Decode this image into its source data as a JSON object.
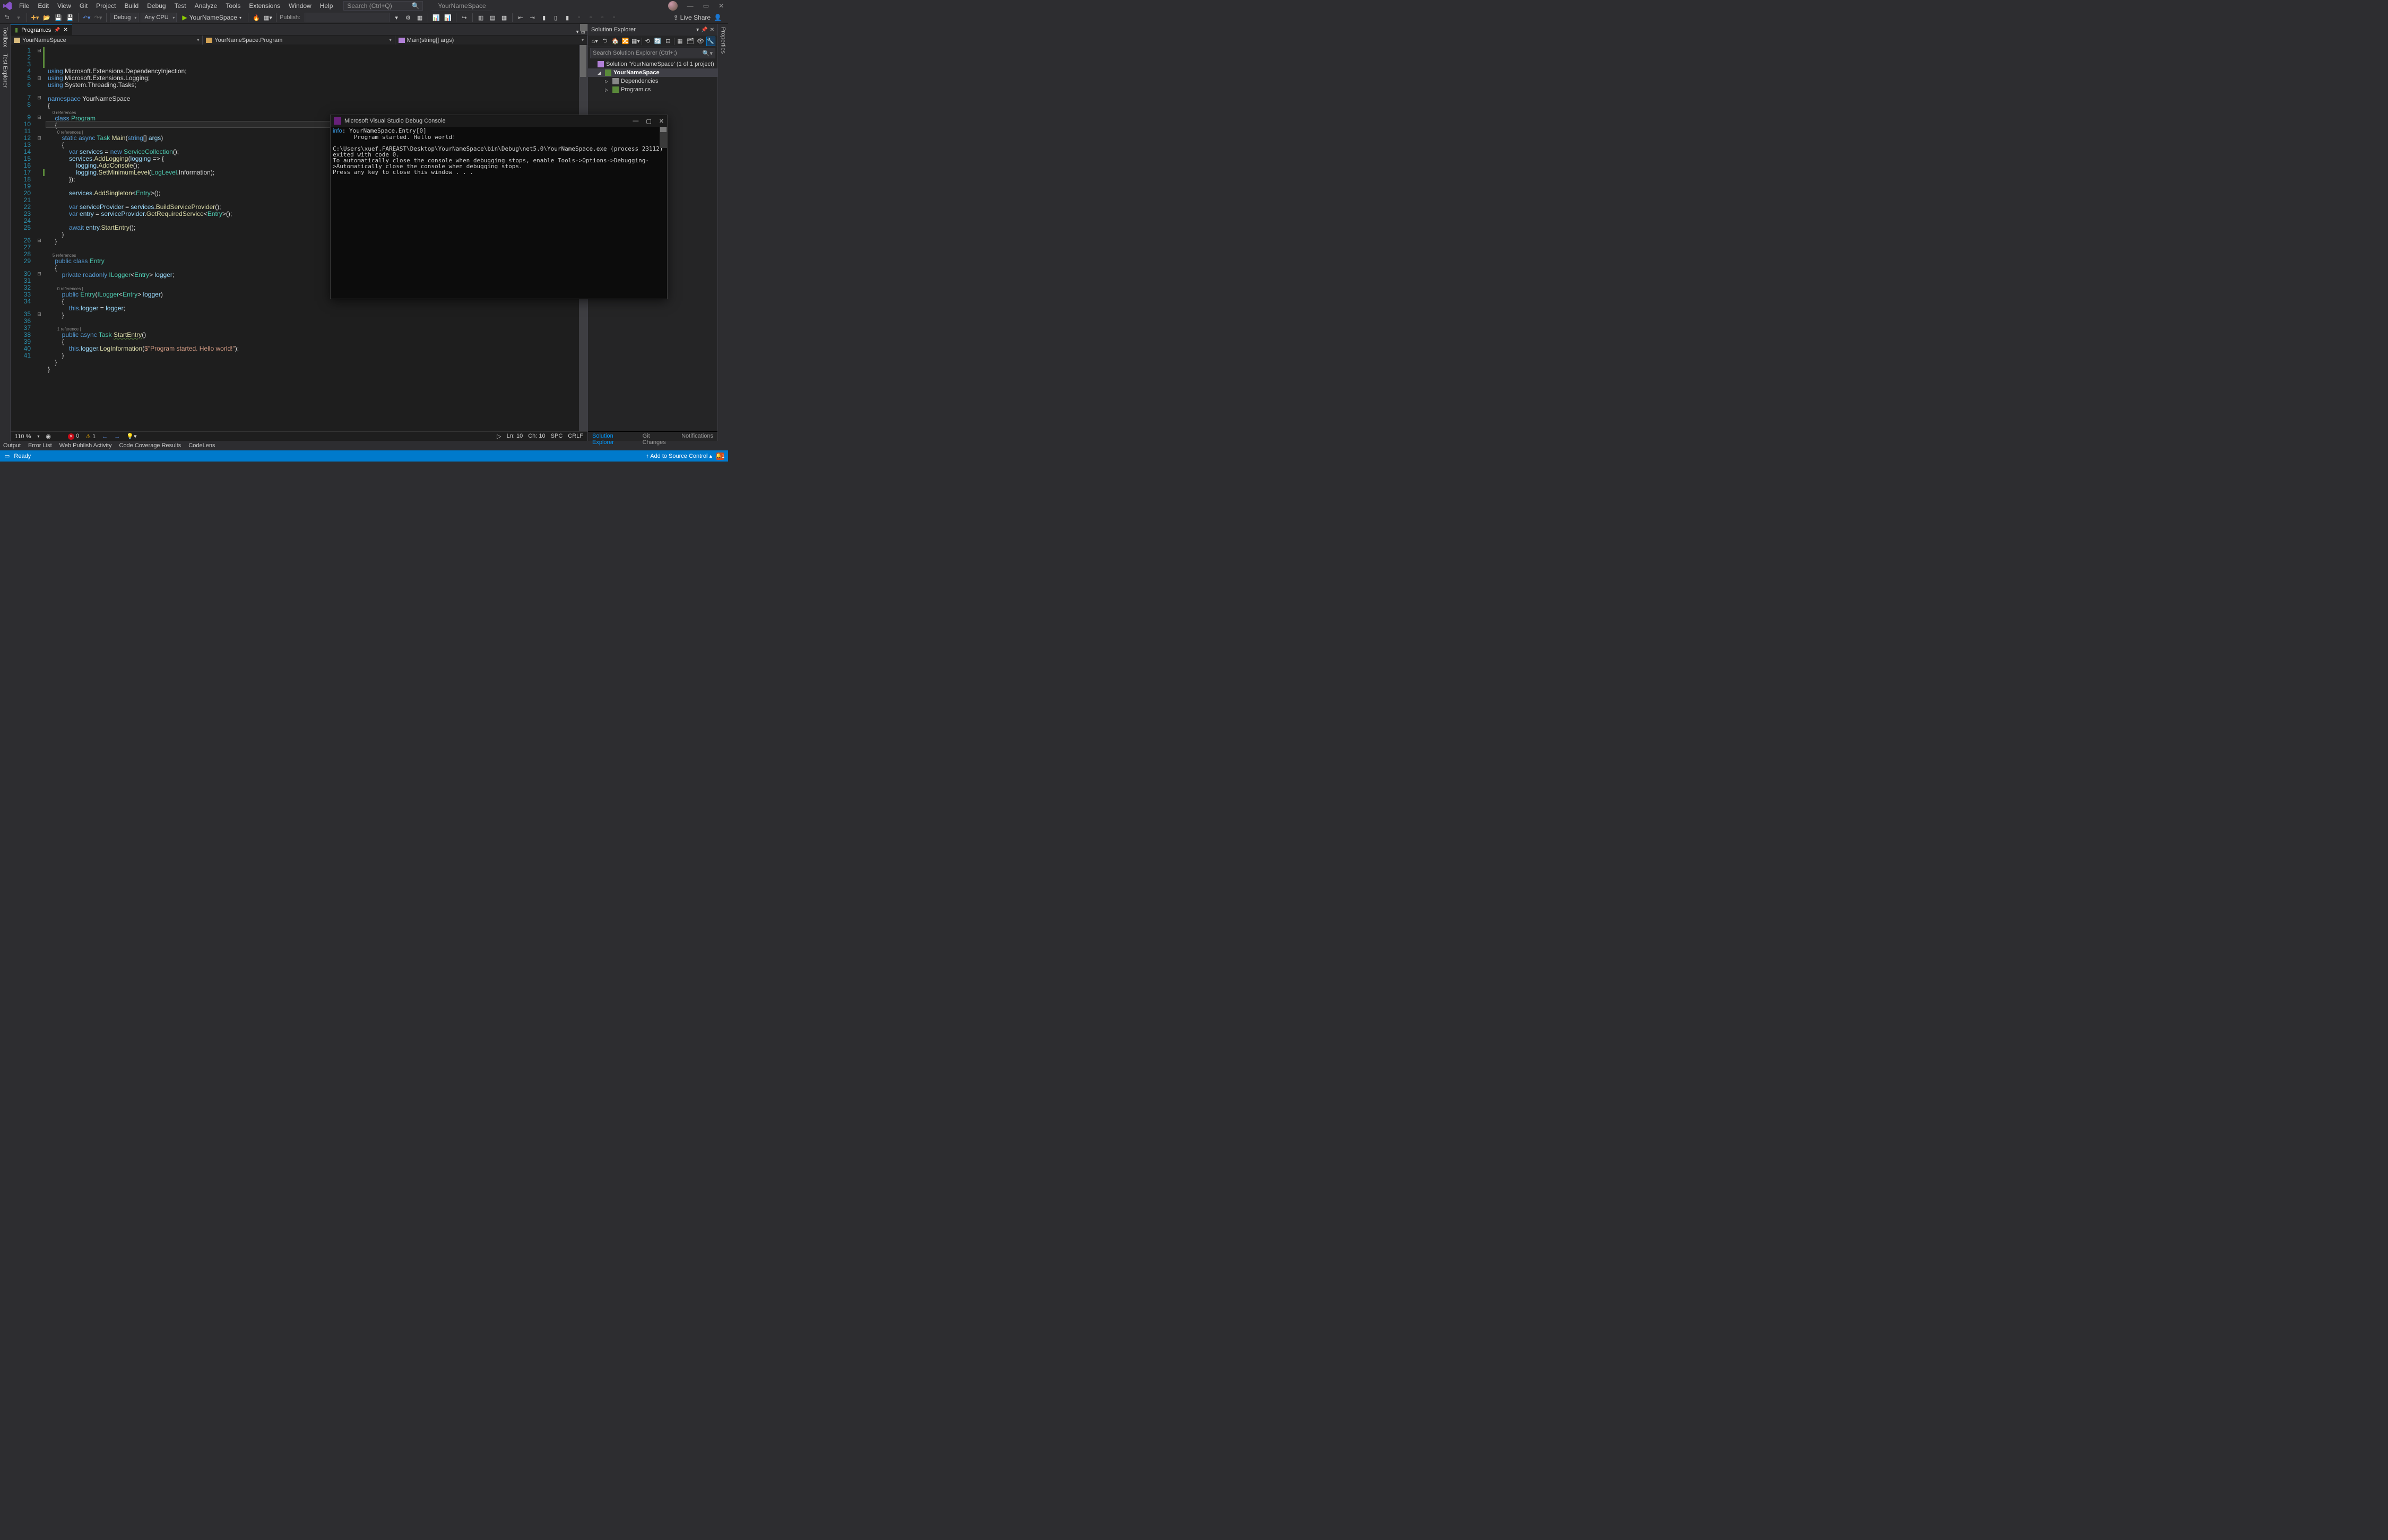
{
  "menu": [
    "File",
    "Edit",
    "View",
    "Git",
    "Project",
    "Build",
    "Debug",
    "Test",
    "Analyze",
    "Tools",
    "Extensions",
    "Window",
    "Help"
  ],
  "search_placeholder": "Search (Ctrl+Q)",
  "title_project": "YourNameSpace",
  "toolbar": {
    "config": "Debug",
    "platform": "Any CPU",
    "start_target": "YourNameSpace",
    "publish_label": "Publish:",
    "live_share": "Live Share"
  },
  "leftrail": [
    "Toolbox",
    "Test Explorer"
  ],
  "rightrail": [
    "Properties"
  ],
  "tab": {
    "name": "Program.cs"
  },
  "nav": {
    "project": "YourNameSpace",
    "class": "YourNameSpace.Program",
    "member": "Main(string[] args)"
  },
  "code": {
    "lines": [
      {
        "n": 1,
        "fold": "⊟",
        "m": "gr",
        "html": "<span class='kw'>using</span> <span class='id'>Microsoft</span>.<span class='id'>Extensions</span>.<span class='id'>DependencyInjection</span>;"
      },
      {
        "n": 2,
        "m": "gr",
        "html": "<span class='kw'>using</span> <span class='id'>Microsoft</span>.<span class='id'>Extensions</span>.<span class='id'>Logging</span>;"
      },
      {
        "n": 3,
        "m": "gr",
        "html": "<span class='kw'>using</span> <span class='id'>System</span>.<span class='id'>Threading</span>.<span class='id'>Tasks</span>;"
      },
      {
        "n": 4,
        "html": ""
      },
      {
        "n": 5,
        "fold": "⊟",
        "html": "<span class='kw'>namespace</span> <span class='id'>YourNameSpace</span>"
      },
      {
        "n": 6,
        "html": "{"
      },
      {
        "ref": "    0 references"
      },
      {
        "n": 7,
        "fold": "⊟",
        "html": "    <span class='kw'>class</span> <span class='ty'>Program</span>"
      },
      {
        "n": 8,
        "html": "    {"
      },
      {
        "ref": "        0 references |"
      },
      {
        "n": 9,
        "fold": "⊟",
        "html": "        <span class='kw'>static</span> <span class='kw'>async</span> <span class='ty'>Task</span> <span class='fn'>Main</span>(<span class='kw'>string</span>[] <span class='va'>args</span>)"
      },
      {
        "n": 10,
        "html": "        {"
      },
      {
        "n": 11,
        "html": "            <span class='kw'>var</span> <span class='va'>services</span> = <span class='kw'>new</span> <span class='ty'>ServiceCollection</span>();"
      },
      {
        "n": 12,
        "fold": "⊟",
        "html": "            <span class='va'>services</span>.<span class='fn'>AddLogging</span>(<span class='va'>logging</span> =&gt; {"
      },
      {
        "n": 13,
        "html": "                <span class='va'>logging</span>.<span class='fn'>AddConsole</span>();"
      },
      {
        "n": 14,
        "html": "                <span class='va'>logging</span>.<span class='fn'>SetMinimumLevel</span>(<span class='ty'>LogLevel</span>.<span class='id'>Information</span>);"
      },
      {
        "n": 15,
        "html": "            });"
      },
      {
        "n": 16,
        "html": ""
      },
      {
        "n": 17,
        "m": "gr",
        "html": "            <span class='va'>services</span>.<span class='fn'>AddSingleton</span>&lt;<span class='ty'>Entry</span>&gt;();"
      },
      {
        "n": 18,
        "html": ""
      },
      {
        "n": 19,
        "html": "            <span class='kw'>var</span> <span class='va'>serviceProvider</span> = <span class='va'>services</span>.<span class='fn'>BuildServiceProvider</span>();"
      },
      {
        "n": 20,
        "html": "            <span class='kw'>var</span> <span class='va'>entry</span> = <span class='va'>serviceProvider</span>.<span class='fn'>GetRequiredService</span>&lt;<span class='ty'>Entry</span>&gt;();"
      },
      {
        "n": 21,
        "html": ""
      },
      {
        "n": 22,
        "html": "            <span class='kw'>await</span> <span class='va'>entry</span>.<span class='fn'>StartEntry</span>();"
      },
      {
        "n": 23,
        "html": "        }"
      },
      {
        "n": 24,
        "html": "    }"
      },
      {
        "n": 25,
        "html": ""
      },
      {
        "ref": "    5 references"
      },
      {
        "n": 26,
        "fold": "⊟",
        "html": "    <span class='kw'>public</span> <span class='kw'>class</span> <span class='ty'>Entry</span>"
      },
      {
        "n": 27,
        "html": "    {"
      },
      {
        "n": 28,
        "html": "        <span class='kw'>private</span> <span class='kw'>readonly</span> <span class='ty'>ILogger</span>&lt;<span class='ty'>Entry</span>&gt; <span class='va'>logger</span>;"
      },
      {
        "n": 29,
        "html": ""
      },
      {
        "ref": "        0 references |"
      },
      {
        "n": 30,
        "fold": "⊟",
        "html": "        <span class='kw'>public</span> <span class='ty'>Entry</span>(<span class='ty'>ILogger</span>&lt;<span class='ty'>Entry</span>&gt; <span class='va'>logger</span>)"
      },
      {
        "n": 31,
        "html": "        {"
      },
      {
        "n": 32,
        "html": "            <span class='kw'>this</span>.<span class='va'>logger</span> = <span class='va'>logger</span>;"
      },
      {
        "n": 33,
        "html": "        }"
      },
      {
        "n": 34,
        "html": ""
      },
      {
        "ref": "        1 reference |"
      },
      {
        "n": 35,
        "fold": "⊟",
        "html": "        <span class='kw'>public</span> <span class='kw'>async</span> <span class='ty'>Task</span> <span class='fn underline'>StartEntry</span>()"
      },
      {
        "n": 36,
        "html": "        {"
      },
      {
        "n": 37,
        "html": "            <span class='kw'>this</span>.<span class='va'>logger</span>.<span class='fn'>LogInformation</span>(<span class='st'>$\"Program started. Hello world!\"</span>);"
      },
      {
        "n": 38,
        "html": "        }"
      },
      {
        "n": 39,
        "html": "    }"
      },
      {
        "n": 40,
        "html": "}"
      },
      {
        "n": 41,
        "html": ""
      }
    ]
  },
  "code_status": {
    "zoom": "110 %",
    "errors": "0",
    "warnings": "1",
    "ln": "Ln: 10",
    "ch": "Ch: 10",
    "spc": "SPC",
    "eol": "CRLF"
  },
  "solexp": {
    "title": "Solution Explorer",
    "search_placeholder": "Search Solution Explorer (Ctrl+;)",
    "nodes": [
      {
        "depth": 0,
        "caret": "",
        "icon": "sln",
        "label": "Solution 'YourNameSpace' (1 of 1 project)"
      },
      {
        "depth": 1,
        "caret": "◢",
        "icon": "cs",
        "label": "YourNameSpace",
        "bold": true,
        "sel": true
      },
      {
        "depth": 2,
        "caret": "▷",
        "icon": "dep",
        "label": "Dependencies"
      },
      {
        "depth": 2,
        "caret": "▷",
        "icon": "file",
        "label": "Program.cs"
      }
    ],
    "tabs": [
      "Solution Explorer",
      "Git Changes",
      "Notifications"
    ]
  },
  "bottom_tabs": [
    "Output",
    "Error List",
    "Web Publish Activity",
    "Code Coverage Results",
    "CodeLens"
  ],
  "status": {
    "ready": "Ready",
    "source_ctrl": "Add to Source Control",
    "notif": "1"
  },
  "console": {
    "title": "Microsoft Visual Studio Debug Console",
    "lines": [
      {
        "cls": "info",
        "text": "info"
      },
      ": YourNameSpace.Entry[0]",
      "      Program started. Hello world!",
      "",
      "C:\\Users\\xuef.FAREAST\\Desktop\\YourNameSpace\\bin\\Debug\\net5.0\\YourNameSpace.exe (process 23112) exited with code 0.",
      "To automatically close the console when debugging stops, enable Tools->Options->Debugging->Automatically close the console when debugging stops.",
      "Press any key to close this window . . ."
    ]
  }
}
